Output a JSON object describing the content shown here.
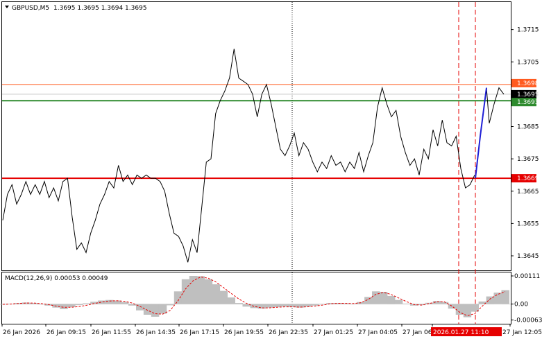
{
  "header": {
    "symbol_label": "GBPUSD,M5",
    "ohlc_text": "1.3695 1.3695 1.3694 1.3695"
  },
  "colors": {
    "price_line": "#000000",
    "projection": "#1f1fd6",
    "resistance_line": "#ff5a1f",
    "entry_line": "#2e8b2e",
    "support_line": "#e60000",
    "bid_tag": "#000000",
    "macd_hist": "#bfbfbf",
    "macd_signal": "#e60000",
    "vline_dashed": "#e60000",
    "grid_dotted": "#000000"
  },
  "chart_data": [
    {
      "type": "line",
      "title": "GBPUSD,M5",
      "x_tick_labels": [
        "26 Jan 2026",
        "26 Jan 09:15",
        "26 Jan 11:55",
        "26 Jan 14:35",
        "26 Jan 17:15",
        "26 Jan 19:55",
        "26 Jan 22:35",
        "27 Jan 01:25",
        "27 Jan 04:05",
        "27 Jan 06:45",
        "2026.01.27 11:10",
        "27 Jan 12:05"
      ],
      "y_tick_labels": [
        "1.3715",
        "1.3705",
        "1.3695",
        "1.3685",
        "1.3675",
        "1.3665",
        "1.3655",
        "1.3645"
      ],
      "ylim": [
        1.36405,
        1.37235
      ],
      "grid": false,
      "price_series_y": [
        1.3656,
        1.3664,
        1.3667,
        1.3661,
        1.3664,
        1.3668,
        1.3664,
        1.3667,
        1.3664,
        1.3668,
        1.3663,
        1.3666,
        1.3662,
        1.3668,
        1.3669,
        1.3657,
        1.3647,
        1.3649,
        1.3646,
        1.3652,
        1.3656,
        1.3661,
        1.3664,
        1.3668,
        1.3666,
        1.3673,
        1.3668,
        1.367,
        1.3667,
        1.367,
        1.3669,
        1.367,
        1.3669,
        1.3669,
        1.3668,
        1.3665,
        1.3658,
        1.3652,
        1.3651,
        1.3648,
        1.3643,
        1.365,
        1.3646,
        1.366,
        1.3674,
        1.3675,
        1.3689,
        1.3693,
        1.3696,
        1.37,
        1.3709,
        1.37,
        1.3699,
        1.3698,
        1.3695,
        1.3688,
        1.3695,
        1.3698,
        1.3692,
        1.3685,
        1.3678,
        1.3676,
        1.3679,
        1.3683,
        1.3676,
        1.368,
        1.3678,
        1.3674,
        1.3671,
        1.3674,
        1.3672,
        1.3676,
        1.3673,
        1.3674,
        1.3671,
        1.3674,
        1.3672,
        1.3677,
        1.3671,
        1.3676,
        1.368,
        1.3691,
        1.3697,
        1.3692,
        1.3688,
        1.369,
        1.3682,
        1.3677,
        1.3673,
        1.3675,
        1.367,
        1.3678,
        1.3675,
        1.3684,
        1.3679,
        1.3687,
        1.368,
        1.3679,
        1.3682,
        1.3672,
        1.3666,
        1.3667,
        1.367
      ],
      "projection_y": [
        1.3669,
        1.3682,
        1.3697
      ],
      "post_projection_y": [
        1.3697,
        1.3686,
        1.3692,
        1.3697,
        1.3695
      ],
      "levels": [
        {
          "label": "1.3698",
          "price": 1.3698
        },
        {
          "label": "1.3693",
          "price": 1.3693
        },
        {
          "label": "1.3669",
          "price": 1.3669
        }
      ],
      "bid_tag": {
        "label": "1.3695",
        "price": 1.3695
      }
    },
    {
      "type": "bar",
      "title": "MACD(12,26,9) 0.00053 0.00049",
      "y_tick_labels": [
        "0.00111",
        "0.00",
        "-0.00063"
      ],
      "ylim": [
        -0.00075,
        0.00122
      ],
      "histogram": [
        -2e-05,
        1e-05,
        4e-05,
        6e-05,
        4e-05,
        0.0,
        -6e-05,
        -0.00014,
        -0.0002,
        -0.00012,
        -4e-05,
        3e-05,
        9e-05,
        0.00014,
        0.00016,
        0.00014,
        8e-05,
        -6e-05,
        -0.00025,
        -0.00042,
        -0.0005,
        -0.00038,
        -5e-05,
        0.0005,
        0.00098,
        0.00111,
        0.0011,
        0.00098,
        0.00078,
        0.00052,
        0.00026,
        4e-05,
        -0.0001,
        -0.00016,
        -0.00018,
        -0.00014,
        -0.00012,
        -0.0001,
        -0.00012,
        -0.00014,
        -0.0001,
        -6e-05,
        -2e-05,
        4e-05,
        4e-05,
        3e-05,
        2e-05,
        8e-05,
        0.00028,
        0.0005,
        0.00048,
        0.00032,
        0.00016,
        2e-05,
        -6e-05,
        -4e-05,
        5e-05,
        0.00012,
        8e-05,
        -0.00018,
        -0.00042,
        -0.00052,
        -0.0003,
        0.0001,
        0.0003,
        0.00045,
        0.00055
      ],
      "signal_line": [
        -1e-05,
        0.0,
        2e-05,
        4e-05,
        4e-05,
        2e-05,
        -2e-05,
        -8e-05,
        -0.00013,
        -0.00013,
        -0.0001,
        -5e-05,
        2e-05,
        8e-05,
        0.00012,
        0.00013,
        0.00011,
        4e-05,
        -9e-05,
        -0.00024,
        -0.00038,
        -0.0004,
        -0.00025,
        0.00012,
        0.0006,
        0.00092,
        0.00107,
        0.00102,
        0.00087,
        0.00065,
        0.00042,
        0.0002,
        3e-05,
        -9e-05,
        -0.00015,
        -0.00015,
        -0.00013,
        -0.00011,
        -0.00011,
        -0.00012,
        -0.00011,
        -8e-05,
        -4e-05,
        1e-05,
        3e-05,
        3e-05,
        2e-05,
        5e-05,
        0.00018,
        0.00038,
        0.00046,
        0.00038,
        0.00024,
        0.0001,
        -2e-05,
        -4e-05,
        2e-05,
        9e-05,
        9e-05,
        -8e-05,
        -0.00032,
        -0.00046,
        -0.00038,
        -8e-05,
        0.0002,
        0.00038,
        0.00049
      ]
    }
  ]
}
